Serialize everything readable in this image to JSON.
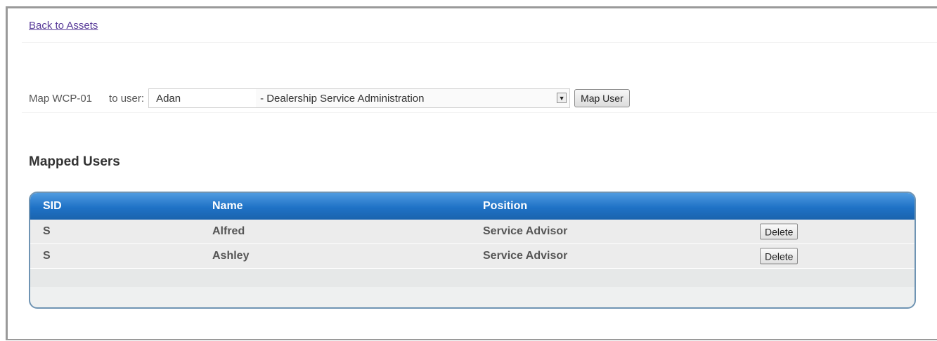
{
  "nav": {
    "back_link": "Back to Assets"
  },
  "map_form": {
    "asset_label": "Map WCP-01",
    "to_user_label": "to user:",
    "selected_user_name": "Adan",
    "selected_user_role": "- Dealership Service Administration",
    "map_button": "Map User"
  },
  "mapped_users": {
    "title": "Mapped Users",
    "columns": [
      "SID",
      "Name",
      "Position",
      ""
    ],
    "rows": [
      {
        "sid": "S",
        "name": "Alfred",
        "position": "Service Advisor",
        "action": "Delete"
      },
      {
        "sid": "S",
        "name": "Ashley",
        "position": "Service Advisor",
        "action": "Delete"
      }
    ]
  },
  "colors": {
    "header_blue": "#1f72c6",
    "link_purple": "#5a3d9a",
    "grid_border": "#6f94b3"
  },
  "icons": {
    "dropdown": "chevron-down-icon"
  }
}
